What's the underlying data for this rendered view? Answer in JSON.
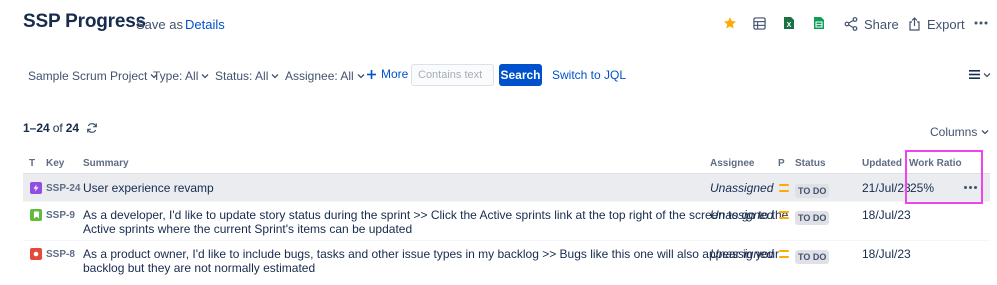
{
  "header": {
    "title": "SSP Progress",
    "save_as": "Save as",
    "details": "Details",
    "share": "Share",
    "export": "Export",
    "icons": [
      "star-icon",
      "list-view-icon",
      "excel-icon",
      "sheets-icon",
      "share-icon",
      "export-icon",
      "more-icon"
    ],
    "colors": {
      "star": "#ffab00",
      "excel": "#1d7044",
      "sheets": "#0f9d58",
      "link": "#0052cc"
    }
  },
  "filters": {
    "project": "Sample Scrum Project",
    "type": "Type: All",
    "status": "Status: All",
    "assignee": "Assignee: All",
    "more": "More",
    "search_placeholder": "Contains text",
    "search_button": "Search",
    "switch_jql": "Switch to JQL"
  },
  "results": {
    "range": "1–24",
    "of": "of",
    "total": "24",
    "columns_button": "Columns"
  },
  "table": {
    "headers": {
      "t": "T",
      "key": "Key",
      "summary": "Summary",
      "assignee": "Assignee",
      "p": "P",
      "status": "Status",
      "updated": "Updated",
      "work_ratio": "Work Ratio"
    },
    "rows": [
      {
        "type": "epic",
        "key": "SSP-24",
        "summary_line1": "User experience revamp",
        "summary_line2": "",
        "assignee": "Unassigned",
        "priority": "medium",
        "status": "TO DO",
        "updated": "21/Jul/23",
        "work_ratio": "25%",
        "selected": true
      },
      {
        "type": "story",
        "key": "SSP-9",
        "summary_line1": "As a developer, I'd like to update story status during the sprint >> Click the Active sprints link at the top right of the screen to go to the",
        "summary_line2": "Active sprints where the current Sprint's items can be updated",
        "assignee": "Unassigned",
        "priority": "medium",
        "status": "TO DO",
        "updated": "18/Jul/23",
        "work_ratio": "",
        "selected": false
      },
      {
        "type": "bug",
        "key": "SSP-8",
        "summary_line1": "As a product owner, I'd like to include bugs, tasks and other issue types in my backlog >> Bugs like this one will also appear in your",
        "summary_line2": "backlog but they are not normally estimated",
        "assignee": "Unassigned",
        "priority": "medium",
        "status": "TO DO",
        "updated": "18/Jul/23",
        "work_ratio": "",
        "selected": false
      }
    ],
    "type_colors": {
      "epic": "#904ee2",
      "story": "#63ba3c",
      "bug": "#e5493a"
    },
    "highlight_color": "#ee44ee"
  }
}
